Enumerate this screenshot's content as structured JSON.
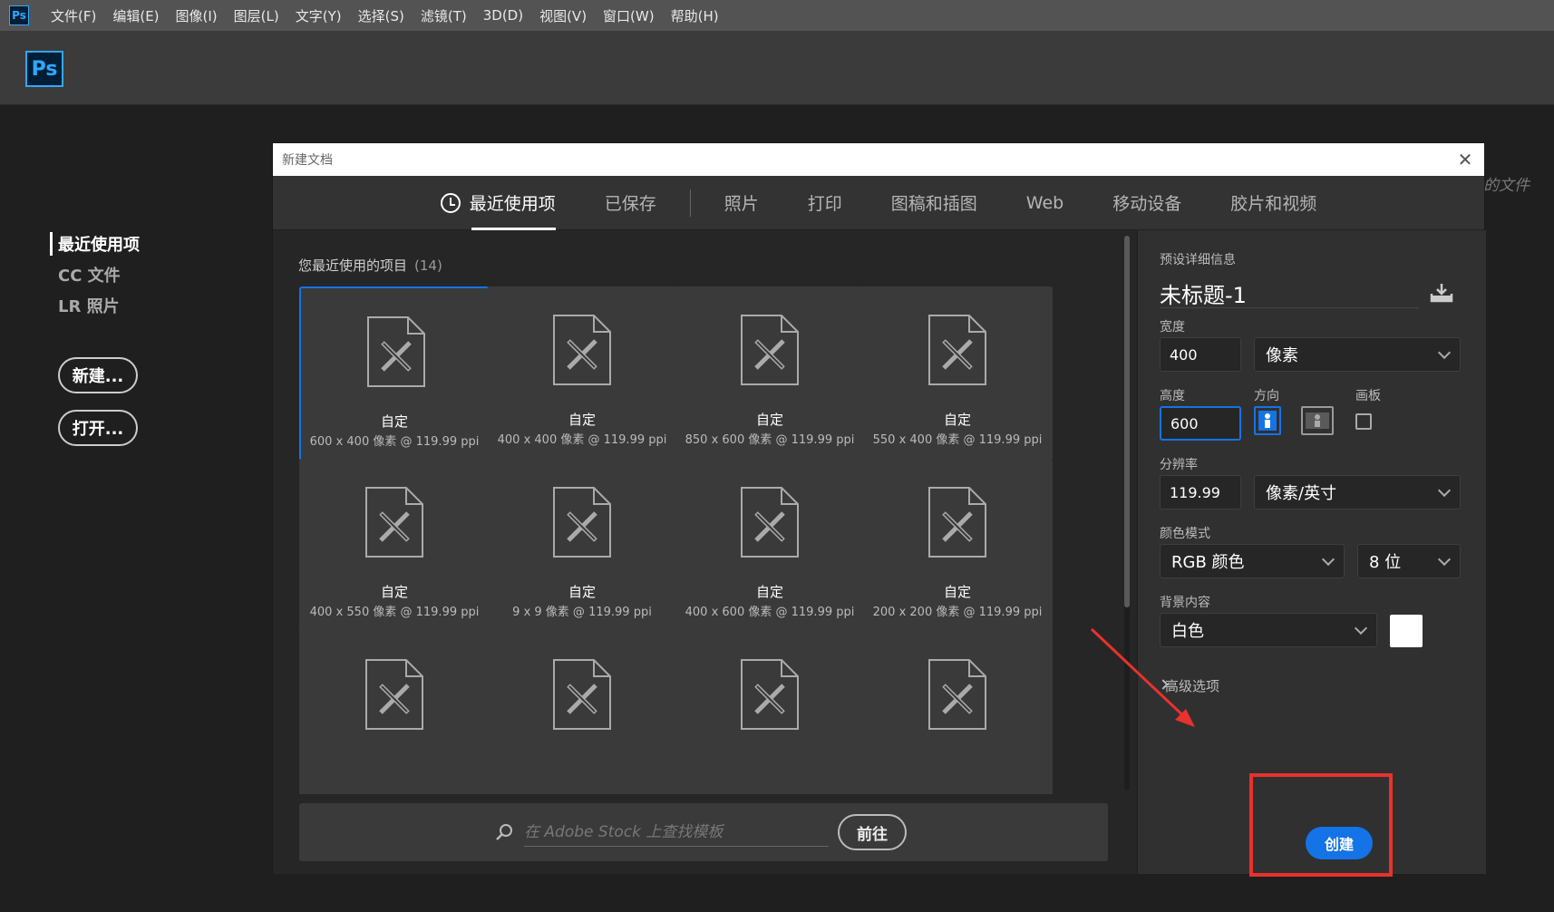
{
  "menubar": {
    "app_icon": "Ps",
    "items": [
      "文件(F)",
      "编辑(E)",
      "图像(I)",
      "图层(L)",
      "文字(Y)",
      "选择(S)",
      "滤镜(T)",
      "3D(D)",
      "视图(V)",
      "窗口(W)",
      "帮助(H)"
    ]
  },
  "topbar": {
    "logo": "Ps"
  },
  "home": {
    "nav": [
      "最近使用项",
      "CC 文件",
      "LR 照片"
    ],
    "new_button": "新建...",
    "open_button": "打开...",
    "right_hint": "的文件"
  },
  "dialog": {
    "title": "新建文档",
    "close_glyph": "✕",
    "tabs": [
      "最近使用项",
      "已保存",
      "照片",
      "打印",
      "图稿和插图",
      "Web",
      "移动设备",
      "胶片和视频"
    ],
    "recent_heading": "您最近使用的项目",
    "recent_count": "(14)",
    "presets": [
      {
        "name": "自定",
        "dim": "600 x 400 像素 @ 119.99 ppi"
      },
      {
        "name": "自定",
        "dim": "400 x 400 像素 @ 119.99 ppi"
      },
      {
        "name": "自定",
        "dim": "850 x 600 像素 @ 119.99 ppi"
      },
      {
        "name": "自定",
        "dim": "550 x 400 像素 @ 119.99 ppi"
      },
      {
        "name": "自定",
        "dim": "400 x 550 像素 @ 119.99 ppi"
      },
      {
        "name": "自定",
        "dim": "9 x 9 像素 @ 119.99 ppi"
      },
      {
        "name": "自定",
        "dim": "400 x 600 像素 @ 119.99 ppi"
      },
      {
        "name": "自定",
        "dim": "200 x 200 像素 @ 119.99 ppi"
      }
    ],
    "stock_placeholder": "在 Adobe Stock 上查找模板",
    "stock_go": "前往",
    "settings": {
      "section_title": "预设详细信息",
      "doc_name": "未标题-1",
      "width_label": "宽度",
      "width_value": "400",
      "unit": "像素",
      "height_label": "高度",
      "height_value": "600",
      "orientation_label": "方向",
      "artboard_label": "画板",
      "resolution_label": "分辨率",
      "resolution_value": "119.99",
      "resolution_unit": "像素/英寸",
      "color_mode_label": "颜色模式",
      "color_mode": "RGB 颜色",
      "bit_depth": "8 位",
      "background_label": "背景内容",
      "background": "白色",
      "advanced": "高级选项",
      "create": "创建"
    }
  },
  "colors": {
    "accent": "#1473e6",
    "ps_blue": "#31a8ff",
    "annotation_red": "#e8322d"
  }
}
